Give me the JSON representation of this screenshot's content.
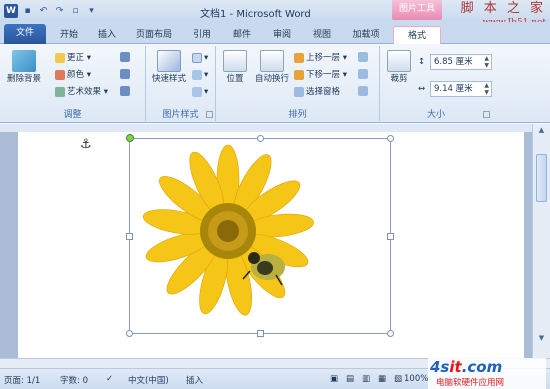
{
  "window": {
    "title": "文档1 - Microsoft Word",
    "context_tab": "图片工具"
  },
  "watermark": {
    "line1": "脚 本 之 家",
    "line2": "www.Jb51.net"
  },
  "tabs": [
    "文件",
    "开始",
    "插入",
    "页面布局",
    "引用",
    "邮件",
    "审阅",
    "视图",
    "加载项",
    "格式"
  ],
  "ribbon": {
    "adjust": {
      "label": "调整",
      "remove_bg": "删除背景",
      "corrections": "更正 ▾",
      "color": "颜色 ▾",
      "artistic": "艺术效果 ▾"
    },
    "styles": {
      "label": "图片样式",
      "quick_styles": "快速样式"
    },
    "arrange": {
      "label": "排列",
      "position": "位置",
      "wrap": "自动换行",
      "bring_forward": "上移一层 ▾",
      "send_backward": "下移一层 ▾",
      "selection_pane": "选择窗格"
    },
    "size": {
      "label": "大小",
      "crop": "裁剪",
      "height": "6.85 厘米",
      "width": "9.14 厘米"
    }
  },
  "status": {
    "page": "页面: 1/1",
    "words": "字数: 0",
    "lang": "中文(中国)",
    "mode": "插入",
    "zoom": "100%"
  },
  "logo": {
    "main_a": "4s",
    "main_b": "it",
    "main_c": ".com",
    "sub": "电脑软硬件应用网"
  },
  "colors": {
    "accent": "#2b579a",
    "context": "#e88ab4",
    "petal": "#f5c518",
    "center": "#b8860b"
  }
}
